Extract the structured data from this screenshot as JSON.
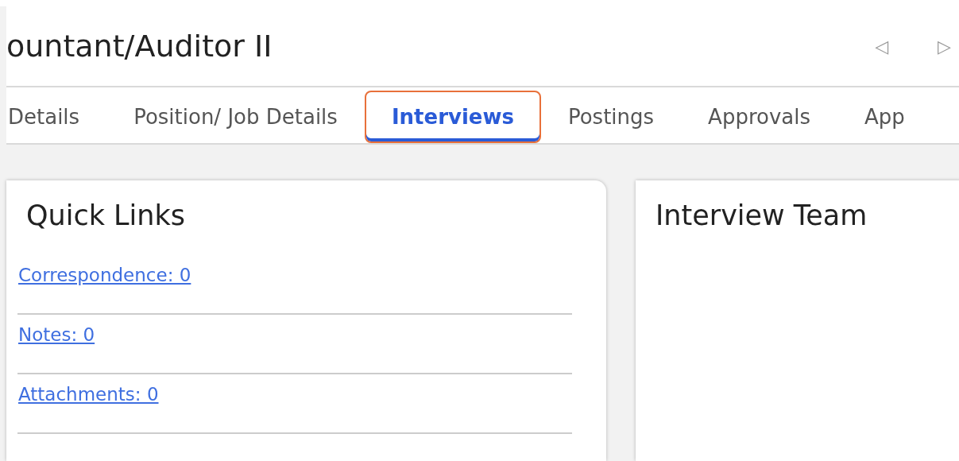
{
  "header": {
    "title": "ountant/Auditor II",
    "prev_symbol": "◁",
    "next_symbol": "▷"
  },
  "tabs": [
    {
      "label": "Details",
      "selected": false,
      "highlighted": false
    },
    {
      "label": "Position/ Job Details",
      "selected": false,
      "highlighted": false
    },
    {
      "label": "Interviews",
      "selected": true,
      "highlighted": true
    },
    {
      "label": "Postings",
      "selected": false,
      "highlighted": false
    },
    {
      "label": "Approvals",
      "selected": false,
      "highlighted": false
    },
    {
      "label": "App",
      "selected": false,
      "highlighted": false
    }
  ],
  "quick_links": {
    "title": "Quick Links",
    "links": [
      "Correspondence: 0",
      "Notes: 0",
      "Attachments: 0"
    ]
  },
  "interview_team": {
    "title": "Interview Team"
  }
}
